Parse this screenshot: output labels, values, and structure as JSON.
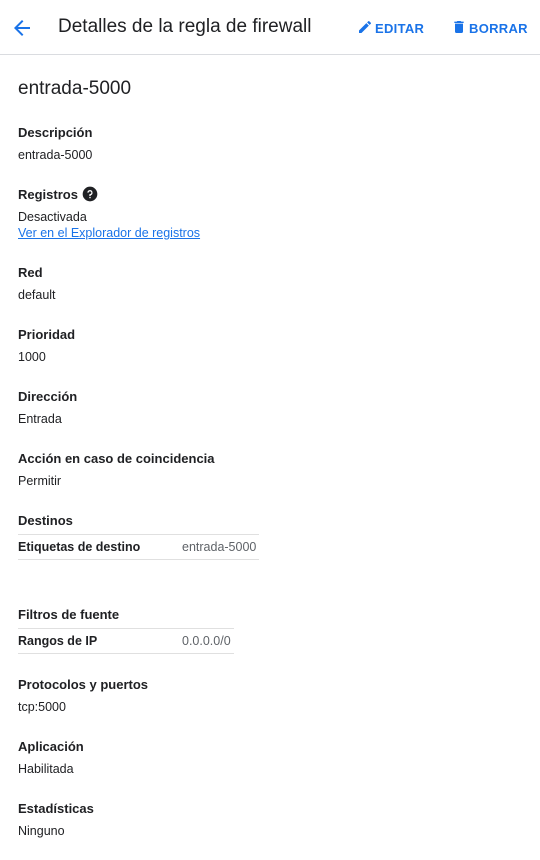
{
  "header": {
    "title": "Detalles de la regla de firewall",
    "edit_label": "EDITAR",
    "delete_label": "BORRAR"
  },
  "rule": {
    "name": "entrada-5000",
    "description_label": "Descripción",
    "description": "entrada-5000",
    "logs_label": "Registros",
    "logs_value": "Desactivada",
    "logs_link": "Ver en el Explorador de registros",
    "network_label": "Red",
    "network": "default",
    "priority_label": "Prioridad",
    "priority": "1000",
    "direction_label": "Dirección",
    "direction": "Entrada",
    "action_label": "Acción en caso de coincidencia",
    "action": "Permitir",
    "targets_label": "Destinos",
    "target_tags_label": "Etiquetas de destino",
    "target_tags": "entrada-5000",
    "source_filters_label": "Filtros de fuente",
    "ip_ranges_label": "Rangos de IP",
    "ip_ranges": "0.0.0.0/0",
    "protocols_label": "Protocolos y puertos",
    "protocols": "tcp:5000",
    "enforcement_label": "Aplicación",
    "enforcement": "Habilitada",
    "stats_label": "Estadísticas",
    "stats": "Ninguno"
  },
  "icons": {
    "back": "arrow-back-icon",
    "edit": "pencil-icon",
    "delete": "trash-icon",
    "help": "help-circle-icon"
  },
  "colors": {
    "accent": "#1a73e8",
    "text": "#202124",
    "secondary_text": "#5f6368",
    "divider": "#dadce0"
  }
}
